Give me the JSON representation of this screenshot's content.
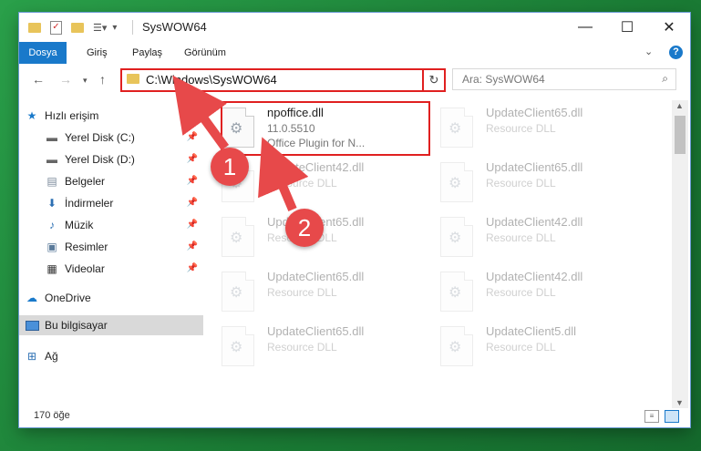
{
  "window": {
    "title": "SysWOW64",
    "controls": {
      "min": "—",
      "max": "☐",
      "close": "✕"
    }
  },
  "ribbon": {
    "tabs": [
      "Dosya",
      "Giriş",
      "Paylaş",
      "Görünüm"
    ]
  },
  "address": {
    "path": "C:\\Windows\\SysWOW64",
    "search_placeholder": "Ara: SysWOW64"
  },
  "sidebar": {
    "quick_access": "Hızlı erişim",
    "items": [
      {
        "label": "Yerel Disk (C:)",
        "icon": "drive-icon",
        "pinned": true
      },
      {
        "label": "Yerel Disk (D:)",
        "icon": "drive-icon",
        "pinned": true
      },
      {
        "label": "Belgeler",
        "icon": "documents-icon",
        "pinned": true
      },
      {
        "label": "İndirmeler",
        "icon": "download-icon",
        "pinned": true
      },
      {
        "label": "Müzik",
        "icon": "music-icon",
        "pinned": true
      },
      {
        "label": "Resimler",
        "icon": "pictures-icon",
        "pinned": true
      },
      {
        "label": "Videolar",
        "icon": "video-icon",
        "pinned": true
      }
    ],
    "onedrive": "OneDrive",
    "this_pc": "Bu bilgisayar",
    "network": "Ağ"
  },
  "files": {
    "selected": {
      "name": "npoffice.dll",
      "version": "11.0.5510",
      "desc": "Office Plugin for N..."
    },
    "grid": [
      {
        "name": "UpdateClient65.dll",
        "type": "Resource DLL"
      },
      {
        "name": "UpdateClient42.dll",
        "type": "Resource DLL"
      },
      {
        "name": "UpdateClient65.dll",
        "type": "Resource DLL"
      },
      {
        "name": "UpdateClient65.dll",
        "type": "Resource DLL"
      },
      {
        "name": "UpdateClient42.dll",
        "type": "Resource DLL"
      },
      {
        "name": "UpdateClient65.dll",
        "type": "Resource DLL"
      },
      {
        "name": "UpdateClient42.dll",
        "type": "Resource DLL"
      },
      {
        "name": "UpdateClient65.dll",
        "type": "Resource DLL"
      },
      {
        "name": "UpdateClient5.dll",
        "type": "Resource DLL"
      }
    ]
  },
  "status": {
    "count": "170 öğe"
  },
  "annotations": {
    "step1": "1",
    "step2": "2"
  },
  "colors": {
    "accent": "#1979ca",
    "highlight": "#e02020",
    "badge": "#e7494a"
  }
}
